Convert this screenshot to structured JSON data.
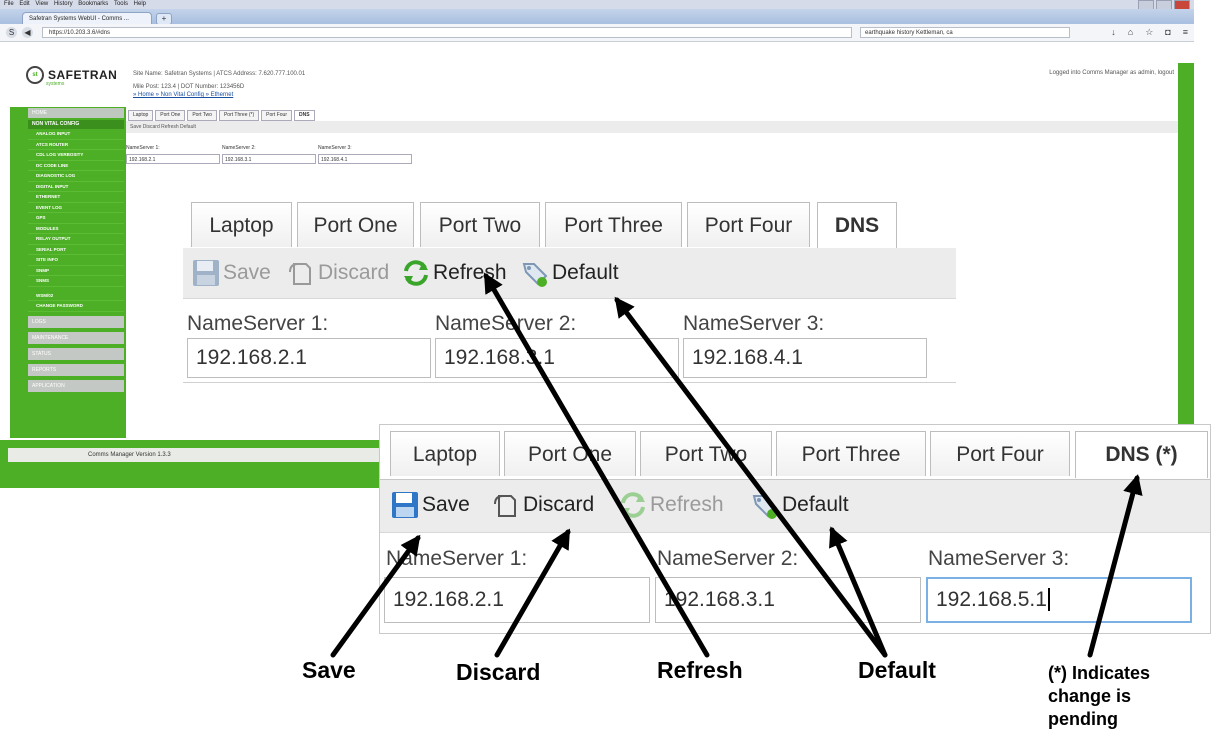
{
  "browser": {
    "menu": [
      "File",
      "Edit",
      "View",
      "History",
      "Bookmarks",
      "Tools",
      "Help"
    ],
    "tab_title": "Safetran Systems WebUI - Comms ...",
    "url": "https://10.203.3.6/#dns",
    "search": "earthquake history Kettleman, ca"
  },
  "header": {
    "logo_text": "SAFETRAN",
    "logo_sub": "systems",
    "site_line": "Site Name: Safetran Systems | ATCS Address: 7.620.777.100.01",
    "mile_line": "Mile Post: 123.4          | DOT Number: 123456D",
    "breadcrumb": "» Home » Non Vital Config » Ethernet",
    "logged_in": "Logged into Comms Manager as admin, logout"
  },
  "sidebar": {
    "top": "HOME",
    "section": "NON VITAL CONFIG",
    "items": [
      "ANALOG INPUT",
      "ATCS ROUTER",
      "CDL LOG VERBOSITY",
      "DC CODE LINE",
      "DIAGNOSTIC LOG",
      "DIGITAL INPUT",
      "ETHERNET",
      "EVENT LOG",
      "GPS",
      "MODULES",
      "RELAY OUTPUT",
      "SERIAL PORT",
      "SITE INFO",
      "SNMP",
      "SNMS",
      "WSM/02",
      "CHANGE PASSWORD"
    ],
    "groups": [
      "LOGS",
      "MAINTENANCE",
      "STATUS",
      "REPORTS",
      "APPLICATION"
    ]
  },
  "footer": {
    "version": "Comms Manager Version 1.3.3"
  },
  "small_ui": {
    "tabs": [
      "Laptop",
      "Port One",
      "Port Two",
      "Port Three (*)",
      "Port Four",
      "DNS"
    ],
    "toolbar": "Save   Discard   Refresh   Default",
    "labels": [
      "NameServer 1:",
      "NameServer 2:",
      "NameServer 3:"
    ],
    "values": [
      "192.168.2.1",
      "192.168.3.1",
      "192.168.4.1"
    ]
  },
  "panel1": {
    "tabs": [
      "Laptop",
      "Port One",
      "Port Two",
      "Port Three",
      "Port Four",
      "DNS"
    ],
    "buttons": {
      "save": "Save",
      "discard": "Discard",
      "refresh": "Refresh",
      "default": "Default"
    },
    "labels": [
      "NameServer 1:",
      "NameServer 2:",
      "NameServer 3:"
    ],
    "values": [
      "192.168.2.1",
      "192.168.3.1",
      "192.168.4.1"
    ]
  },
  "panel2": {
    "tabs": [
      "Laptop",
      "Port One",
      "Port Two",
      "Port Three",
      "Port Four",
      "DNS (*)"
    ],
    "buttons": {
      "save": "Save",
      "discard": "Discard",
      "refresh": "Refresh",
      "default": "Default"
    },
    "labels": [
      "NameServer 1:",
      "NameServer 2:",
      "NameServer 3:"
    ],
    "values": [
      "192.168.2.1",
      "192.168.3.1",
      "192.168.5.1"
    ]
  },
  "annotations": {
    "save": "Save",
    "discard": "Discard",
    "refresh": "Refresh",
    "default": "Default",
    "pending_note": "(*) Indicates change is pending"
  },
  "colors": {
    "brand_green": "#4caf25",
    "save_blue": "#2f76c6",
    "refresh_green": "#3aa42b"
  }
}
